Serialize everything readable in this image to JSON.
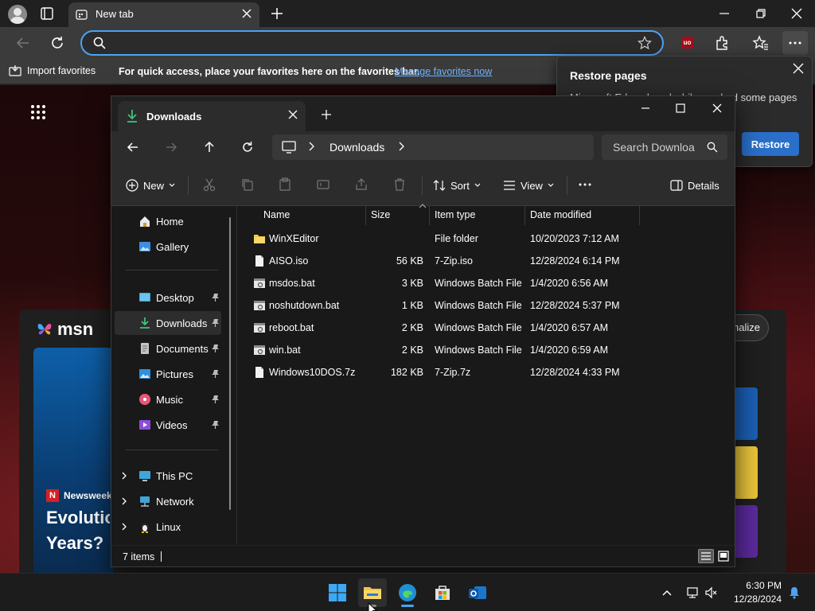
{
  "browser": {
    "tab_title": "New tab",
    "address_value": "",
    "favorites_bar": {
      "import_label": "Import favorites",
      "hint": "For quick access, place your favorites here on the favorites bar.",
      "manage_link": "Manage favorites now"
    },
    "extension_badge": "uo"
  },
  "restore_popup": {
    "title": "Restore pages",
    "message": "Microsoft Edge closed while you had some pages",
    "button": "Restore"
  },
  "new_tab_page": {
    "brand": "msn",
    "personalize_label": "nalize",
    "news_source": "Newsweek",
    "news_source_letter": "N",
    "news_title": "Evolutio Years?"
  },
  "explorer": {
    "tab_title": "Downloads",
    "breadcrumb": "Downloads",
    "search_placeholder": "Search Downloa",
    "commands": {
      "new": "New",
      "sort": "Sort",
      "view": "View",
      "details": "Details"
    },
    "sidebar": {
      "items": [
        {
          "label": "Home",
          "icon": "home-icon"
        },
        {
          "label": "Gallery",
          "icon": "gallery-icon"
        },
        {
          "label": "Desktop",
          "icon": "desktop-icon",
          "pinned": true
        },
        {
          "label": "Downloads",
          "icon": "downloads-icon",
          "pinned": true,
          "active": true
        },
        {
          "label": "Documents",
          "icon": "documents-icon",
          "pinned": true
        },
        {
          "label": "Pictures",
          "icon": "pictures-icon",
          "pinned": true
        },
        {
          "label": "Music",
          "icon": "music-icon",
          "pinned": true
        },
        {
          "label": "Videos",
          "icon": "videos-icon",
          "pinned": true
        },
        {
          "label": "This PC",
          "icon": "this-pc-icon",
          "expandable": true
        },
        {
          "label": "Network",
          "icon": "network-icon",
          "expandable": true
        },
        {
          "label": "Linux",
          "icon": "linux-icon",
          "expandable": true
        }
      ]
    },
    "columns": [
      "Name",
      "Size",
      "Item type",
      "Date modified"
    ],
    "files": [
      {
        "name": "WinXEditor",
        "size": "",
        "type": "File folder",
        "date": "10/20/2023 7:12 AM",
        "icon": "folder-icon"
      },
      {
        "name": "AISO.iso",
        "size": "56 KB",
        "type": "7-Zip.iso",
        "date": "12/28/2024 6:14 PM",
        "icon": "file-icon"
      },
      {
        "name": "msdos.bat",
        "size": "3 KB",
        "type": "Windows Batch File",
        "date": "1/4/2020 6:56 AM",
        "icon": "batch-file-icon"
      },
      {
        "name": "noshutdown.bat",
        "size": "1 KB",
        "type": "Windows Batch File",
        "date": "12/28/2024 5:37 PM",
        "icon": "batch-file-icon"
      },
      {
        "name": "reboot.bat",
        "size": "2 KB",
        "type": "Windows Batch File",
        "date": "1/4/2020 6:57 AM",
        "icon": "batch-file-icon"
      },
      {
        "name": "win.bat",
        "size": "2 KB",
        "type": "Windows Batch File",
        "date": "1/4/2020 6:59 AM",
        "icon": "batch-file-icon"
      },
      {
        "name": "Windows10DOS.7z",
        "size": "182 KB",
        "type": "7-Zip.7z",
        "date": "12/28/2024 4:33 PM",
        "icon": "file-icon"
      }
    ],
    "status": "7 items"
  },
  "taskbar": {
    "time": "6:30 PM",
    "date": "12/28/2024"
  },
  "colors": {
    "accent": "#4aa3f4",
    "restore_button": "#2a6fc9",
    "folder": "#f4c542",
    "link": "#6cb4ff"
  }
}
